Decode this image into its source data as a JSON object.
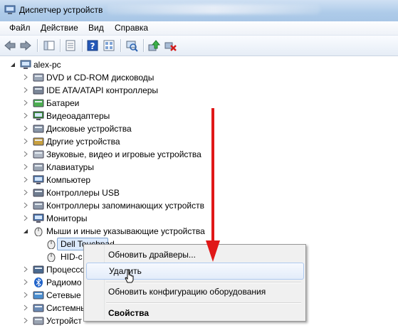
{
  "window": {
    "title": "Диспетчер устройств"
  },
  "menu": [
    "Файл",
    "Действие",
    "Вид",
    "Справка"
  ],
  "toolbar_icons": [
    "back-icon",
    "forward-icon",
    "show-hide-icon",
    "properties-icon",
    "help-icon",
    "view-icon",
    "scan-hardware-icon",
    "update-driver-icon",
    "uninstall-icon"
  ],
  "tree": {
    "root": "alex-pc",
    "items": [
      {
        "label": "DVD и CD-ROM дисководы",
        "icon": "dvd-drive-icon",
        "expanded": false
      },
      {
        "label": "IDE ATA/ATAPI контроллеры",
        "icon": "ide-controller-icon",
        "expanded": false
      },
      {
        "label": "Батареи",
        "icon": "battery-icon",
        "expanded": false
      },
      {
        "label": "Видеоадаптеры",
        "icon": "display-adapter-icon",
        "expanded": false
      },
      {
        "label": "Дисковые устройства",
        "icon": "disk-drive-icon",
        "expanded": false
      },
      {
        "label": "Другие устройства",
        "icon": "other-devices-icon",
        "expanded": false
      },
      {
        "label": "Звуковые, видео и игровые устройства",
        "icon": "sound-icon",
        "expanded": false
      },
      {
        "label": "Клавиатуры",
        "icon": "keyboard-icon",
        "expanded": false
      },
      {
        "label": "Компьютер",
        "icon": "computer-icon",
        "expanded": false
      },
      {
        "label": "Контроллеры USB",
        "icon": "usb-icon",
        "expanded": false
      },
      {
        "label": "Контроллеры запоминающих устройств",
        "icon": "storage-controller-icon",
        "expanded": false
      },
      {
        "label": "Мониторы",
        "icon": "monitor-icon",
        "expanded": false
      },
      {
        "label": "Мыши и иные указывающие устройства",
        "icon": "mouse-icon",
        "expanded": true
      }
    ],
    "children": [
      {
        "label": "Dell Touchpad",
        "selected": true
      },
      {
        "label": "HID-с"
      }
    ],
    "after": [
      {
        "label": "Процессо",
        "icon": "processor-icon"
      },
      {
        "label": "Радиомо",
        "icon": "bluetooth-icon"
      },
      {
        "label": "Сетевые а",
        "icon": "network-icon"
      },
      {
        "label": "Системны",
        "icon": "system-devices-icon"
      },
      {
        "label": "Устройст",
        "icon": "hid-icon"
      }
    ]
  },
  "context_menu": {
    "update_drivers": "Обновить драйверы...",
    "uninstall": "Удалить",
    "scan": "Обновить конфигурацию оборудования",
    "properties": "Свойства"
  },
  "colors": {
    "annotation_arrow": "#e01818",
    "selection": "#dceafc"
  }
}
